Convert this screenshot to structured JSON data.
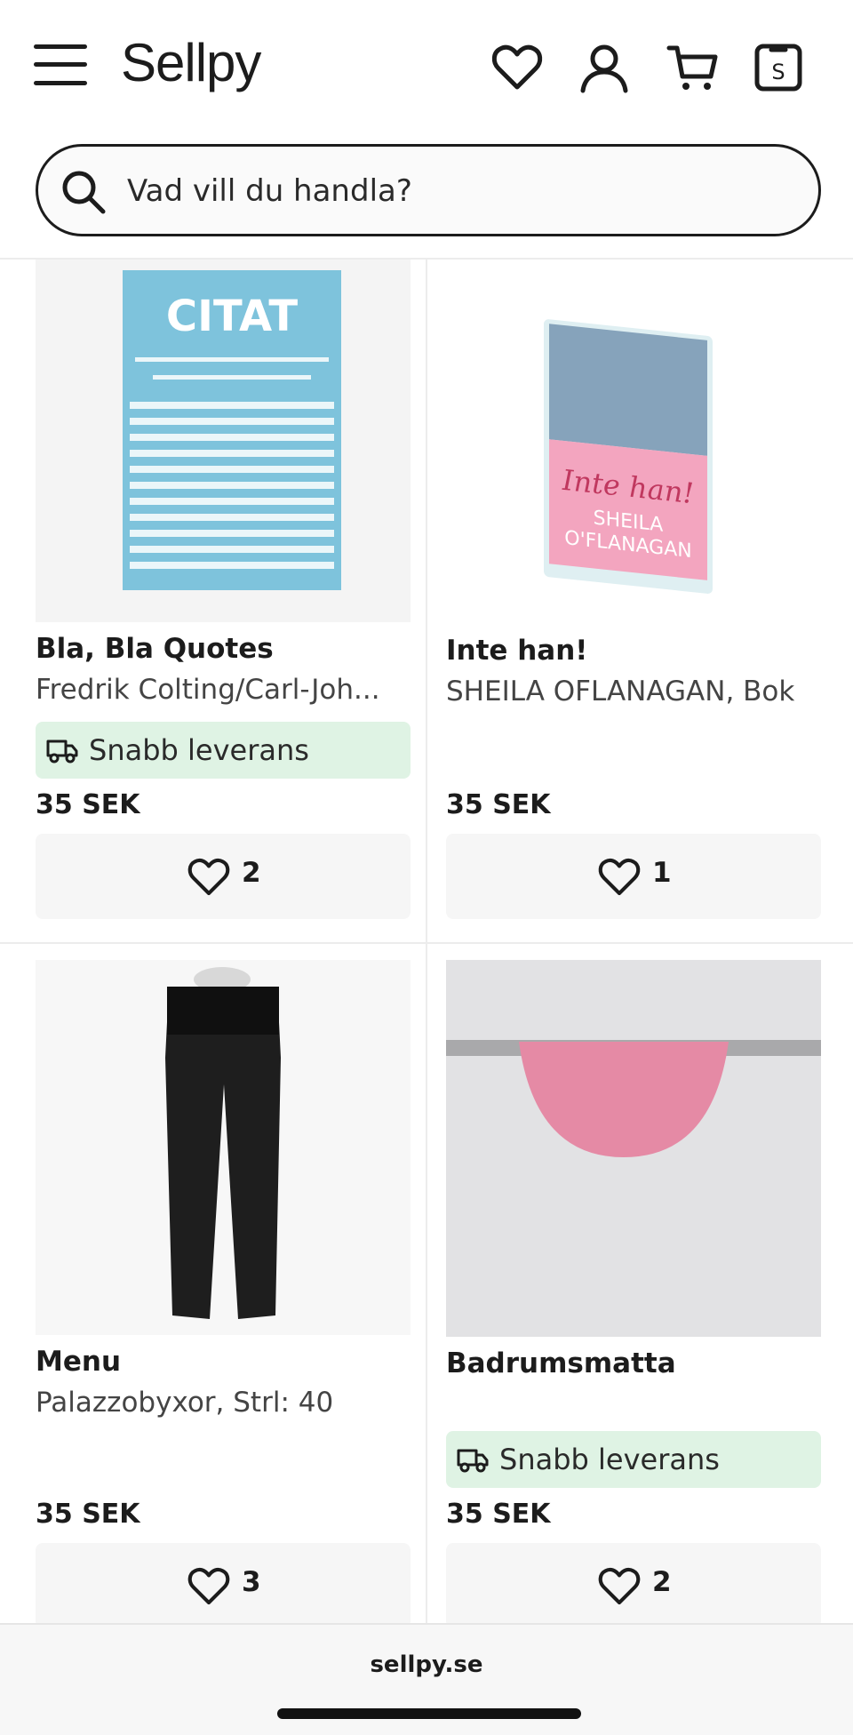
{
  "header": {
    "logo": "Sellpy",
    "icons": [
      "hamburger-menu-icon",
      "heart-icon",
      "user-icon",
      "cart-icon",
      "sell-icon"
    ]
  },
  "search": {
    "placeholder": "Vad vill du handla?"
  },
  "products": [
    {
      "title": "Bla, Bla Quotes",
      "subtitle": "Fredrik Colting/Carl-Joh...",
      "badge": "Snabb leverans",
      "price": "35 SEK",
      "favorites": "2",
      "image": "citat-book-cover"
    },
    {
      "title": "Inte han!",
      "subtitle": "SHEILA OFLANAGAN, Bok",
      "badge": "",
      "price": "35 SEK",
      "favorites": "1",
      "image": "inte-han-book"
    },
    {
      "title": "Menu",
      "subtitle": "Palazzobyxor, Strl: 40",
      "badge": "",
      "price": "35 SEK",
      "favorites": "3",
      "image": "black-trousers"
    },
    {
      "title": "Badrumsmatta",
      "subtitle": "",
      "badge": "Snabb leverans",
      "price": "35 SEK",
      "favorites": "2",
      "image": "pink-bath-mat"
    }
  ],
  "image_text": {
    "citat_title": "CITAT",
    "inte_han_title": "Inte han!",
    "inte_han_author1": "SHEILA",
    "inte_han_author2": "O'FLANAGAN"
  },
  "browser": {
    "url": "sellpy.se"
  },
  "colors": {
    "badge_bg": "#dff3e4",
    "fav_bg": "#f6f6f6",
    "text": "#1c1c1c"
  }
}
